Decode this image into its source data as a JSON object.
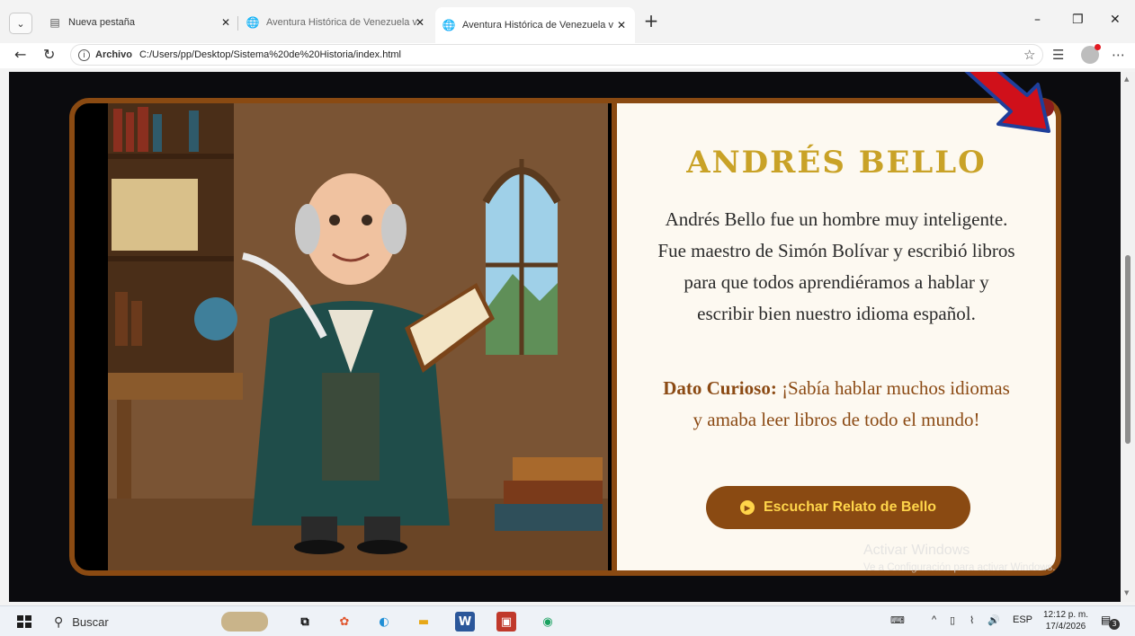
{
  "browser": {
    "tabs": [
      {
        "title": "Nueva pestaña",
        "close": "✕"
      },
      {
        "title": "Aventura Histórica de Venezuela v",
        "close": "✕"
      },
      {
        "title": "Aventura Histórica de Venezuela v",
        "close": "✕"
      }
    ],
    "new_tab": "+",
    "window_controls": {
      "minimize": "–",
      "restore": "❐",
      "close": "✕"
    },
    "address": {
      "scheme_label": "Archivo",
      "url": "C:/Users/pp/Desktop/Sistema%20de%20Historia/index.html"
    }
  },
  "page": {
    "card": {
      "title": "ANDRÉS BELLO",
      "description": "Andrés Bello fue un hombre muy inteligente. Fue maestro de Simón Bolívar y escribió libros para que todos aprendiéramos a hablar y escribir bien nuestro idioma español.",
      "fact_label": "Dato Curioso:",
      "fact_text": " ¡Sabía hablar muchos idiomas y amaba leer libros de todo el mundo!",
      "listen_button": "Escuchar Relato de Bello"
    },
    "watermark": {
      "line1": "Activar Windows",
      "line2": "Ve a Configuración para activar Windows."
    }
  },
  "taskbar": {
    "search_placeholder": "Buscar",
    "tray": {
      "language": "ESP"
    },
    "clock": {
      "time": "12:12 p. m.",
      "date": "17/4/2026"
    },
    "notification_count": "3"
  },
  "colors": {
    "card_border": "#8a4a12",
    "title_gold": "#c9a227",
    "button_bg": "#8a4a12",
    "button_text": "#ffd54a",
    "arrow_red": "#d0101a"
  }
}
